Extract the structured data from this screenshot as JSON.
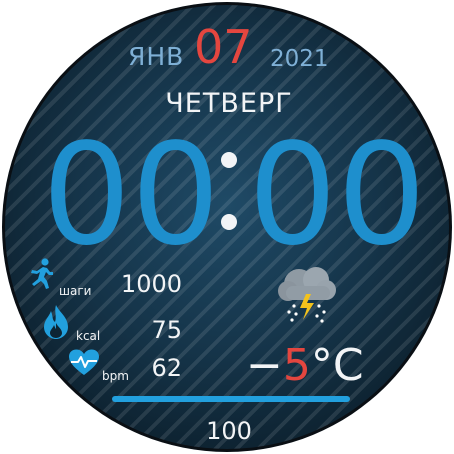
{
  "date": {
    "month": "ЯНВ",
    "day": "07",
    "year": "2021"
  },
  "weekday": "ЧЕТВЕРГ",
  "time": {
    "hours": "00",
    "minutes": "00"
  },
  "stats": {
    "steps": {
      "label": "шаги",
      "value": "1000",
      "icon": "runner-icon"
    },
    "calories": {
      "label": "kcal",
      "value": "75",
      "icon": "flame-icon"
    },
    "heart_rate": {
      "label": "bpm",
      "value": "62",
      "icon": "heart-pulse-icon"
    }
  },
  "weather": {
    "icon": "thunderstorm-icon",
    "temperature": "5",
    "sign": "−",
    "unit": "°C"
  },
  "battery": {
    "value": "100",
    "fraction": 1.0
  },
  "colors": {
    "accent": "#22a0de",
    "time": "#1e8fcd",
    "highlight": "#e4463f",
    "text": "#f2f4f6",
    "muted": "#7fb0d6"
  }
}
